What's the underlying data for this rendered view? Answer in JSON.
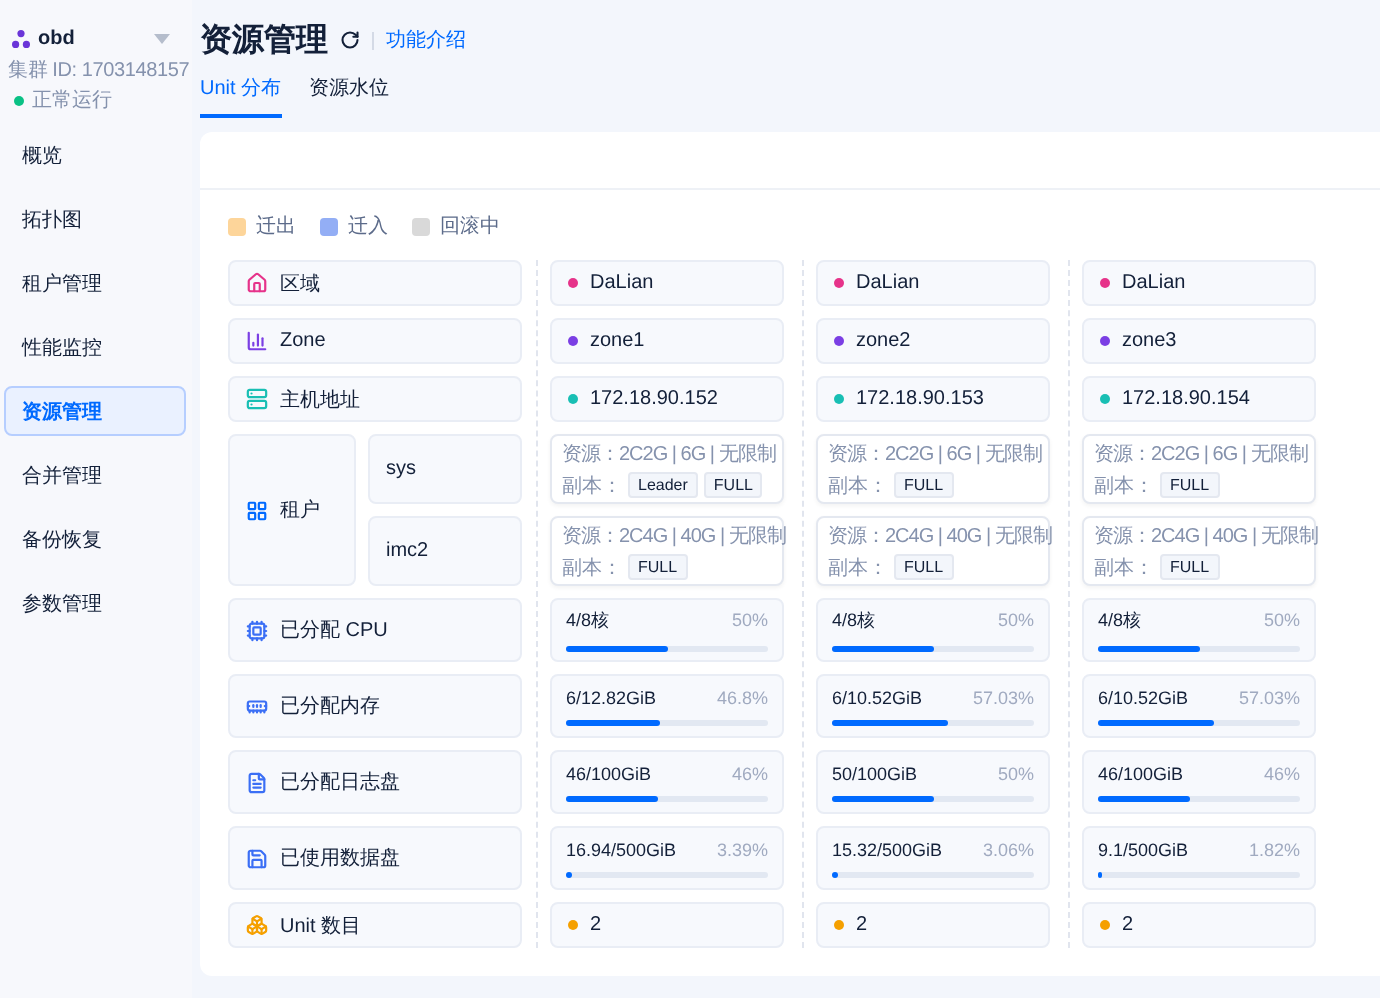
{
  "sidebar": {
    "cluster_name": "obd",
    "cluster_id": "集群 ID: 1703148157",
    "status": "正常运行",
    "items": [
      {
        "label": "概览",
        "selected": false
      },
      {
        "label": "拓扑图",
        "selected": false
      },
      {
        "label": "租户管理",
        "selected": false
      },
      {
        "label": "性能监控",
        "selected": false
      },
      {
        "label": "资源管理",
        "selected": true
      },
      {
        "label": "合并管理",
        "selected": false
      },
      {
        "label": "备份恢复",
        "selected": false
      },
      {
        "label": "参数管理",
        "selected": false
      }
    ]
  },
  "header": {
    "title": "资源管理",
    "help_link": "功能介绍",
    "tabs": [
      {
        "label": "Unit 分布",
        "selected": true
      },
      {
        "label": "资源水位",
        "selected": false
      }
    ]
  },
  "legend": [
    {
      "label": "迁出",
      "color": "#fdd59a"
    },
    {
      "label": "迁入",
      "color": "#93aef5"
    },
    {
      "label": "回滚中",
      "color": "#d9d9d9"
    }
  ],
  "rows": [
    {
      "kind": "region",
      "label": "区域"
    },
    {
      "kind": "zone",
      "label": "Zone"
    },
    {
      "kind": "host",
      "label": "主机地址"
    },
    {
      "kind": "tenant",
      "label": "租户",
      "tenants": [
        "sys",
        "imc2"
      ]
    },
    {
      "kind": "cpu",
      "label": "已分配 CPU"
    },
    {
      "kind": "memory",
      "label": "已分配内存"
    },
    {
      "kind": "log_disk",
      "label": "已分配日志盘"
    },
    {
      "kind": "data_disk",
      "label": "已使用数据盘"
    },
    {
      "kind": "units",
      "label": "Unit 数目"
    }
  ],
  "servers": [
    {
      "region": "DaLian",
      "zone": "zone1",
      "host": "172.18.90.152",
      "tenants": [
        {
          "resource": "资源：2C2G | 6G | 无限制",
          "replica_label": "副本：",
          "replicas": [
            "Leader",
            "FULL"
          ]
        },
        {
          "resource": "资源：2C4G | 40G | 无限制",
          "replica_label": "副本：",
          "replicas": [
            "FULL"
          ]
        }
      ],
      "cpu": {
        "usage": "4/8核",
        "percent": "50%",
        "level": 0.5
      },
      "memory": {
        "usage": "6/12.82GiB",
        "percent": "46.8%",
        "level": 0.468
      },
      "log_disk": {
        "usage": "46/100GiB",
        "percent": "46%",
        "level": 0.46
      },
      "data_disk": {
        "usage": "16.94/500GiB",
        "percent": "3.39%",
        "level": 0.0339
      },
      "units": "2"
    },
    {
      "region": "DaLian",
      "zone": "zone2",
      "host": "172.18.90.153",
      "tenants": [
        {
          "resource": "资源：2C2G | 6G | 无限制",
          "replica_label": "副本：",
          "replicas": [
            "FULL"
          ]
        },
        {
          "resource": "资源：2C4G | 40G | 无限制",
          "replica_label": "副本：",
          "replicas": [
            "FULL"
          ]
        }
      ],
      "cpu": {
        "usage": "4/8核",
        "percent": "50%",
        "level": 0.5
      },
      "memory": {
        "usage": "6/10.52GiB",
        "percent": "57.03%",
        "level": 0.5703
      },
      "log_disk": {
        "usage": "50/100GiB",
        "percent": "50%",
        "level": 0.5
      },
      "data_disk": {
        "usage": "15.32/500GiB",
        "percent": "3.06%",
        "level": 0.0306
      },
      "units": "2"
    },
    {
      "region": "DaLian",
      "zone": "zone3",
      "host": "172.18.90.154",
      "tenants": [
        {
          "resource": "资源：2C2G | 6G | 无限制",
          "replica_label": "副本：",
          "replicas": [
            "FULL"
          ]
        },
        {
          "resource": "资源：2C4G | 40G | 无限制",
          "replica_label": "副本：",
          "replicas": [
            "FULL"
          ]
        }
      ],
      "cpu": {
        "usage": "4/8核",
        "percent": "50%",
        "level": 0.5
      },
      "memory": {
        "usage": "6/10.52GiB",
        "percent": "57.03%",
        "level": 0.5703
      },
      "log_disk": {
        "usage": "46/100GiB",
        "percent": "46%",
        "level": 0.46
      },
      "data_disk": {
        "usage": "9.1/500GiB",
        "percent": "1.82%",
        "level": 0.0182
      },
      "units": "2"
    }
  ]
}
